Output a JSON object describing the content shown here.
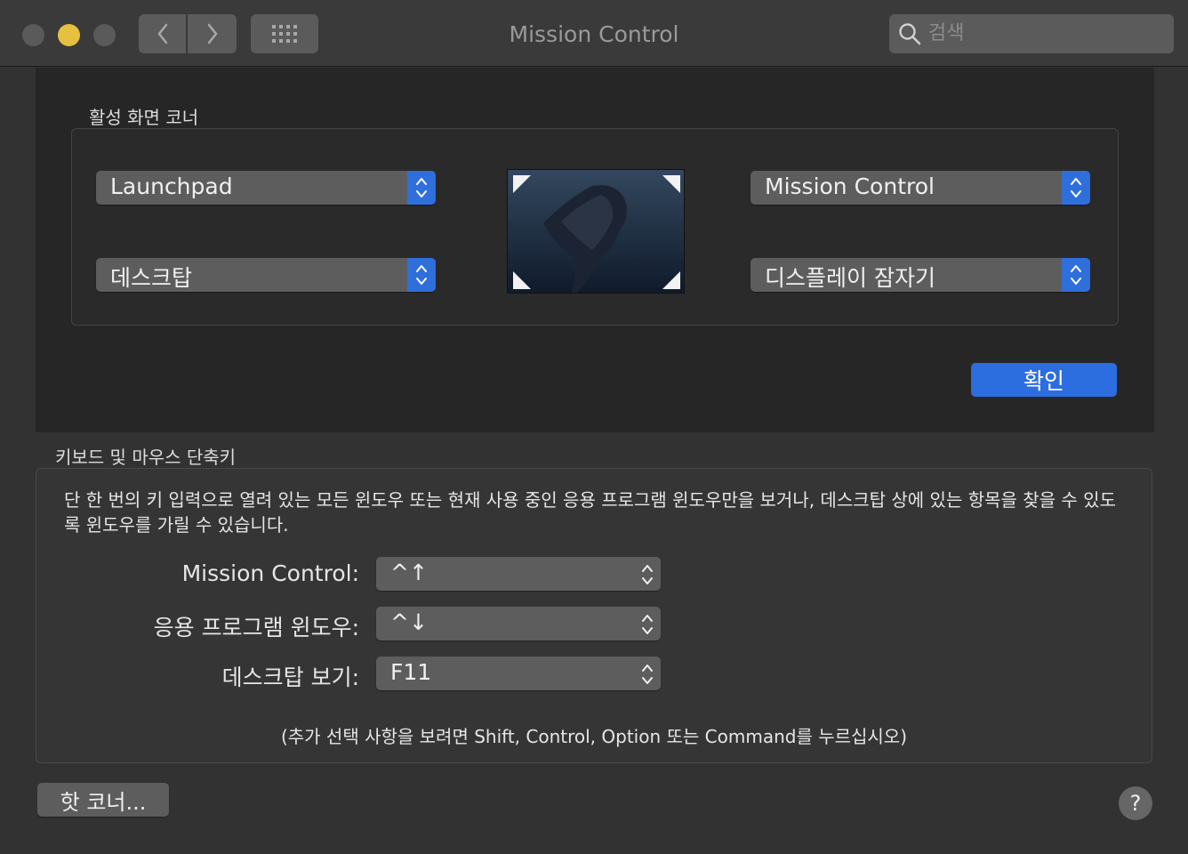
{
  "window": {
    "title": "Mission Control",
    "search": {
      "placeholder": "검색",
      "value": ""
    }
  },
  "hot_corners": {
    "section_label": "활성 화면 코너",
    "top_left": "Launchpad",
    "bottom_left": "데스크탑",
    "top_right": "Mission Control",
    "bottom_right": "디스플레이 잠자기",
    "ok_label": "확인"
  },
  "keyboard": {
    "section_label": "키보드 및 마우스 단축키",
    "description": "단 한 번의 키 입력으로 열려 있는 모든 윈도우 또는 현재 사용 중인 응용 프로그램 윈도우만을 보거나, 데스크탑 상에 있는 항목을 찾을 수 있도록 윈도우를 가릴 수 있습니다.",
    "rows": [
      {
        "label": "Mission Control:",
        "value": "^↑"
      },
      {
        "label": "응용 프로그램 윈도우:",
        "value": "^↓"
      },
      {
        "label": "데스크탑 보기:",
        "value": "F11"
      }
    ],
    "hint": "(추가 선택 사항을 보려면 Shift, Control, Option 또는 Command를 누르십시오)"
  },
  "footer": {
    "hot_corners_button": "핫 코너...",
    "help_button": "?"
  },
  "colors": {
    "accent": "#2c6ee0",
    "window_bg": "#323232",
    "sheet_bg": "#262626",
    "minimize": "#e6c140"
  },
  "icons": [
    "close-button",
    "minimize-button",
    "zoom-button",
    "back-chevron-icon",
    "forward-chevron-icon",
    "grid-icon",
    "search-icon",
    "updown-chevron-icon",
    "help-icon"
  ]
}
